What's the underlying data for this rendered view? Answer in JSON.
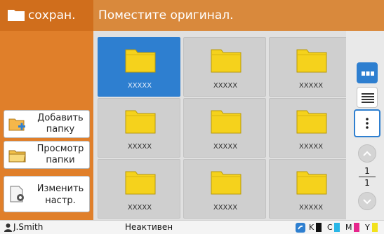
{
  "sidebar": {
    "title": "сохран.",
    "buttons": [
      {
        "line1": "Добавить",
        "line2": "папку",
        "icon": "folder-add-icon"
      },
      {
        "line1": "Просмотр",
        "line2": "папки",
        "icon": "folder-view-icon"
      },
      {
        "line1": "Изменить",
        "line2": "настр.",
        "icon": "settings-doc-icon"
      }
    ]
  },
  "header": {
    "message": "Поместите оригинал."
  },
  "folders": [
    {
      "label": "XXXXX",
      "selected": true
    },
    {
      "label": "XXXXX"
    },
    {
      "label": "XXXXX"
    },
    {
      "label": "XXXXX"
    },
    {
      "label": "XXXXX"
    },
    {
      "label": "XXXXX"
    },
    {
      "label": "XXXXX"
    },
    {
      "label": "XXXXX"
    },
    {
      "label": "XXXXX"
    }
  ],
  "pager": {
    "current": "1",
    "total": "1"
  },
  "footer": {
    "user": "J.Smith",
    "status": "Неактивен",
    "inks": [
      {
        "label": "K",
        "color": "#111111"
      },
      {
        "label": "C",
        "color": "#29b6e6"
      },
      {
        "label": "M",
        "color": "#e6268c"
      },
      {
        "label": "Y",
        "color": "#f2e21c"
      }
    ]
  },
  "colors": {
    "accent": "#e07f2a",
    "selected": "#2e7fd0",
    "folder": "#f5d21c"
  }
}
